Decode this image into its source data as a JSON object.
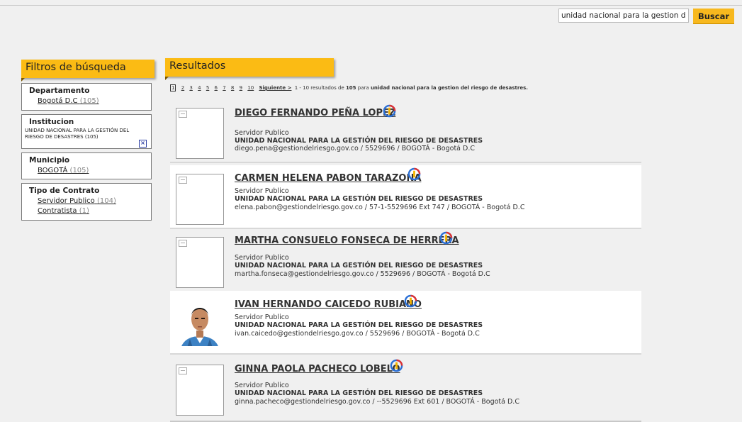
{
  "search": {
    "value": "unidad nacional para la gestion del",
    "button_label": "Buscar"
  },
  "filters": {
    "title": "Filtros de búsqueda",
    "departamento": {
      "title": "Departamento",
      "items": [
        {
          "label": "Bogotá D.C",
          "count": "(105)"
        }
      ]
    },
    "institucion": {
      "title": "Institucion",
      "selected": "UNIDAD NACIONAL PARA LA GESTIÓN DEL RIESGO DE DESASTRES (105)"
    },
    "municipio": {
      "title": "Municipio",
      "items": [
        {
          "label": "BOGOTÁ",
          "count": "(105)"
        }
      ]
    },
    "tipo_contrato": {
      "title": "Tipo de Contrato",
      "items": [
        {
          "label": "Servidor Publico",
          "count": "(104)"
        },
        {
          "label": "Contratista",
          "count": "(1)"
        }
      ]
    }
  },
  "results": {
    "title": "Resultados",
    "pager": {
      "pages": [
        "1",
        "2",
        "3",
        "4",
        "5",
        "6",
        "7",
        "8",
        "9",
        "10"
      ],
      "next_label": "Siguiente >",
      "range_text": "1 - 10 resultados de",
      "total": "105",
      "para_text": "para",
      "query": "unidad nacional para la gestion del riesgo de desastres."
    },
    "items": [
      {
        "name": "DIEGO FERNANDO PEÑA LOPEZ",
        "role": "Servidor Publico",
        "org": "UNIDAD NACIONAL PARA LA GESTIÓN DEL RIESGO DE DESASTRES",
        "contact": "diego.pena@gestiondelriesgo.gov.co  / 5529696  / BOGOTÁ - Bogotá D.C"
      },
      {
        "name": "CARMEN HELENA PABON TARAZONA",
        "role": "Servidor Publico",
        "org": "UNIDAD NACIONAL PARA LA GESTIÓN DEL RIESGO DE DESASTRES",
        "contact": "elena.pabon@gestiondelriesgo.gov.co  / 57-1-5529696 Ext 747  / BOGOTÁ - Bogotá D.C"
      },
      {
        "name": "MARTHA CONSUELO FONSECA DE HERRERA",
        "role": "Servidor Publico",
        "org": "UNIDAD NACIONAL PARA LA GESTIÓN DEL RIESGO DE DESASTRES",
        "contact": "martha.fonseca@gestiondelriesgo.gov.co  / 5529696  / BOGOTÁ - Bogotá D.C"
      },
      {
        "name": "IVAN HERNANDO CAICEDO RUBIANO",
        "role": "Servidor Publico",
        "org": "UNIDAD NACIONAL PARA LA GESTIÓN DEL RIESGO DE DESASTRES",
        "contact": "ivan.caicedo@gestiondelriesgo.gov.co  / 5529696  / BOGOTÁ - Bogotá D.C"
      },
      {
        "name": "GINNA PAOLA PACHECO LOBELO",
        "role": "Servidor Publico",
        "org": "UNIDAD NACIONAL PARA LA GESTIÓN DEL RIESGO DE DESASTRES",
        "contact": "ginna.pacheco@gestiondelriesgo.gov.co  / --5529696 Ext 601  / BOGOTÁ - Bogotá D.C"
      }
    ]
  },
  "colors": {
    "accent": "#fbbb14",
    "button": "#f7b81e",
    "remove_icon": "#2d3fa3"
  }
}
